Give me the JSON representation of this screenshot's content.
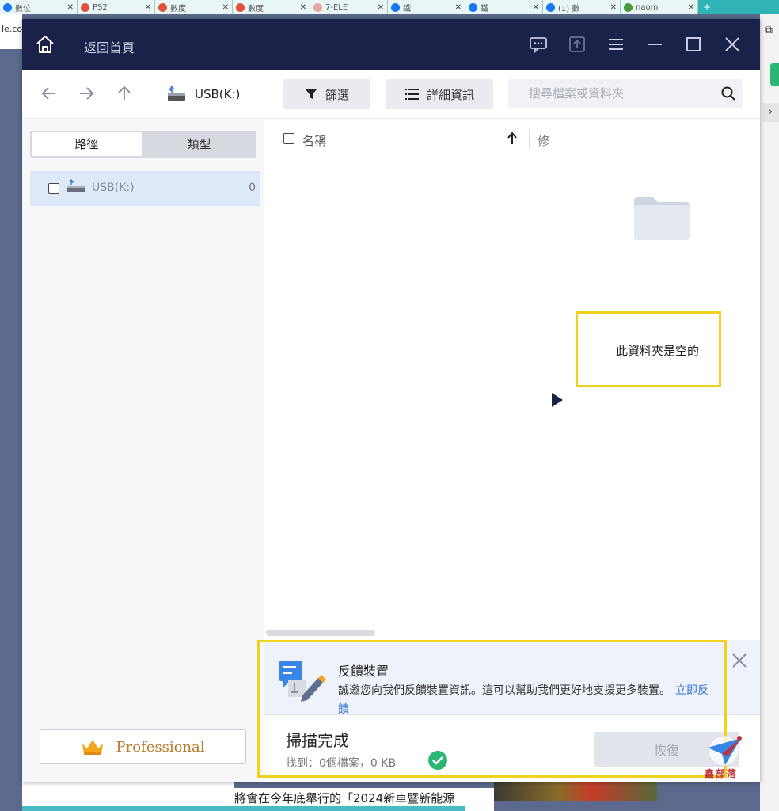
{
  "browser": {
    "tabs": [
      {
        "label": "數位",
        "color": "#1877f2"
      },
      {
        "label": "PS2",
        "color": "#e0533a"
      },
      {
        "label": "數度",
        "color": "#e0533a"
      },
      {
        "label": "數度",
        "color": "#e0533a"
      },
      {
        "label": "7-ELE",
        "color": "#e7a6a0"
      },
      {
        "label": "鐵",
        "color": "#1877f2"
      },
      {
        "label": "鐵",
        "color": "#1877f2"
      },
      {
        "label": "(1) 數",
        "color": "#1877f2"
      },
      {
        "label": "naom",
        "color": "#4a9a3a"
      }
    ],
    "address_fragment": "le.co"
  },
  "titlebar": {
    "home_label": "返回首頁",
    "icons": [
      "feedback-icon",
      "upload-icon",
      "menu-icon",
      "minimize-icon",
      "maximize-icon",
      "close-icon"
    ]
  },
  "navbar": {
    "drive_label": "USB(K:)",
    "filter_label": "篩選",
    "details_label": "詳細資訊",
    "search_placeholder": "搜尋檔案或資料夾"
  },
  "sidebar": {
    "tab_path": "路徑",
    "tab_type": "類型",
    "tree": [
      {
        "label": "USB(K:)",
        "count": "0"
      }
    ],
    "professional_label": "Professional"
  },
  "filelist": {
    "col_name": "名稱",
    "col_modified": "修"
  },
  "preview": {
    "empty_text": "此資料夾是空的"
  },
  "feedback": {
    "title": "反饋裝置",
    "body": "誠邀您向我們反饋裝置資訊。這可以幫助我們更好地支援更多裝置。",
    "link": "立即反饋"
  },
  "status": {
    "title": "掃描完成",
    "found": "找到：0個檔案，0 KB",
    "recover_label": "恢復"
  },
  "watermark": {
    "text": "鑫部落"
  },
  "behind_page": {
    "text": "將會在今年底舉行的「2024新車暨新能源"
  },
  "colors": {
    "titlebar": "#1b2249",
    "highlight": "#f1d21e",
    "accent_link": "#2f6fd6",
    "success": "#2bb673"
  }
}
